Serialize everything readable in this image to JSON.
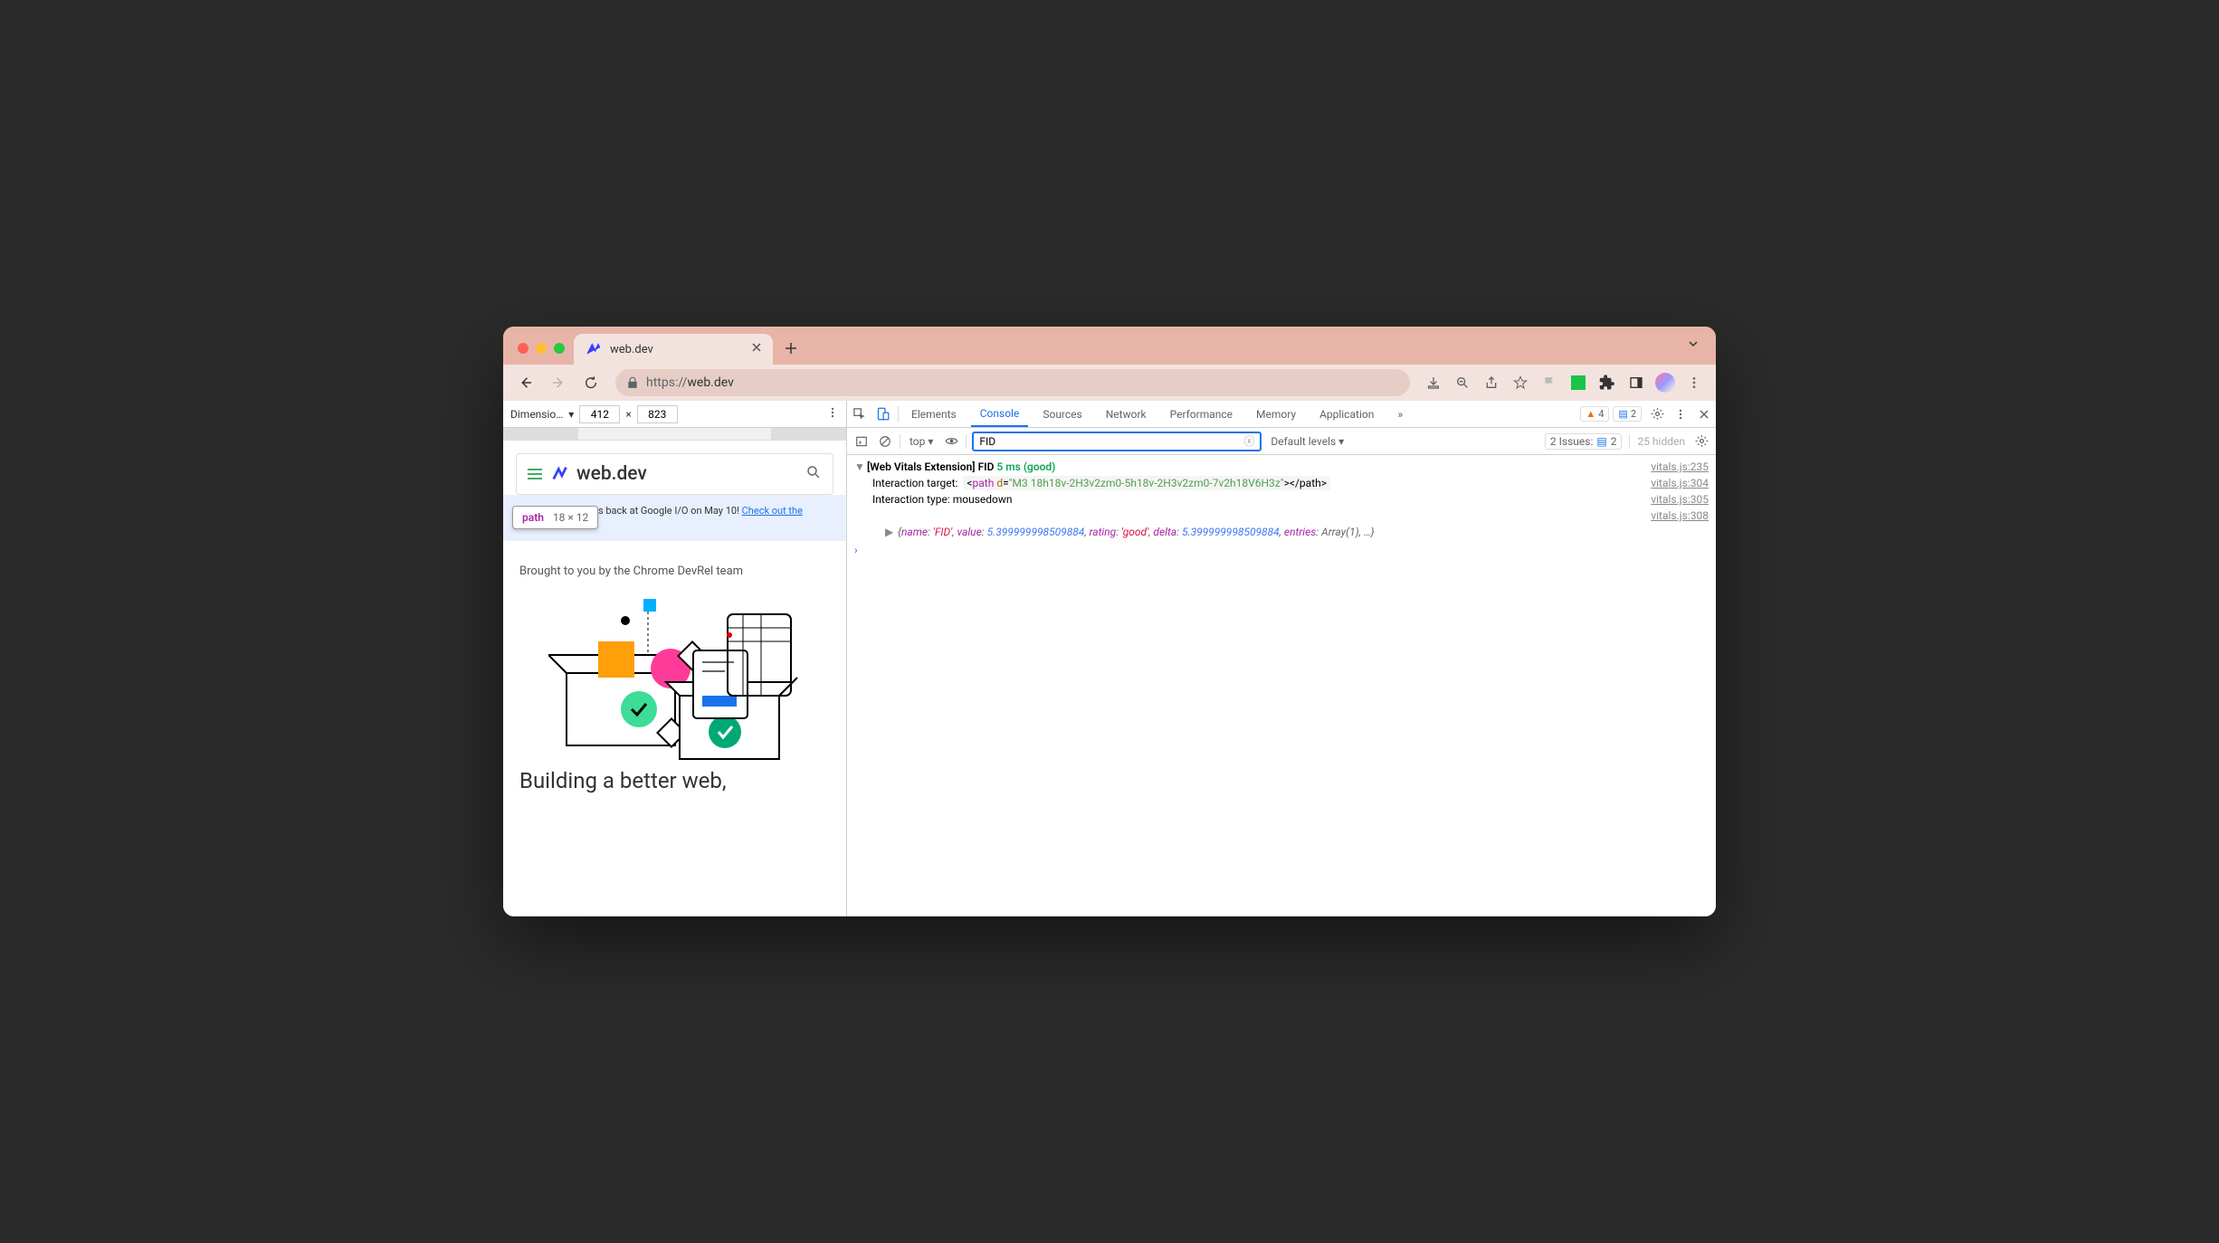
{
  "tab": {
    "title": "web.dev"
  },
  "url": {
    "protocol": "https://",
    "host": "web.dev"
  },
  "dimensions": {
    "label": "Dimensio…",
    "width": "412",
    "height": "823"
  },
  "tooltip": {
    "tag": "path",
    "size": "18 × 12"
  },
  "site": {
    "logo": "web.dev",
    "banner_text": "The Chrome team is back at Google I/O on May 10! ",
    "banner_link": "Check out the sessions",
    "intro": "Brought to you by the Chrome DevRel team",
    "headline": "Building a better web,"
  },
  "devtools": {
    "tabs": [
      "Elements",
      "Console",
      "Sources",
      "Network",
      "Performance",
      "Memory",
      "Application"
    ],
    "active": "Console",
    "warnings": "4",
    "messages": "2",
    "context": "top",
    "filter": "FID",
    "levels": "Default levels",
    "issues_label": "2 Issues:",
    "issues_count": "2",
    "hidden": "25 hidden"
  },
  "log": {
    "l1_prefix": "[Web Vitals Extension] FID",
    "l1_metric": "5 ms (good)",
    "l1_src": "vitals.js:235",
    "l2_label": "Interaction target:",
    "l2_tag": "path",
    "l2_attr": "d",
    "l2_val": "\"M3 18h18v-2H3v2zm0-5h18v-2H3v2zm0-7v2h18V6H3z\"",
    "l2_close": "</path>",
    "l2_src": "vitals.js:304",
    "l3_label": "Interaction type:",
    "l3_val": "mousedown",
    "l3_src": "vitals.js:305",
    "l4_src": "vitals.js:308",
    "obj": {
      "name": "'FID'",
      "value": "5.399999998509884",
      "rating": "'good'",
      "delta": "5.399999998509884",
      "entries": "Array(1)"
    }
  }
}
